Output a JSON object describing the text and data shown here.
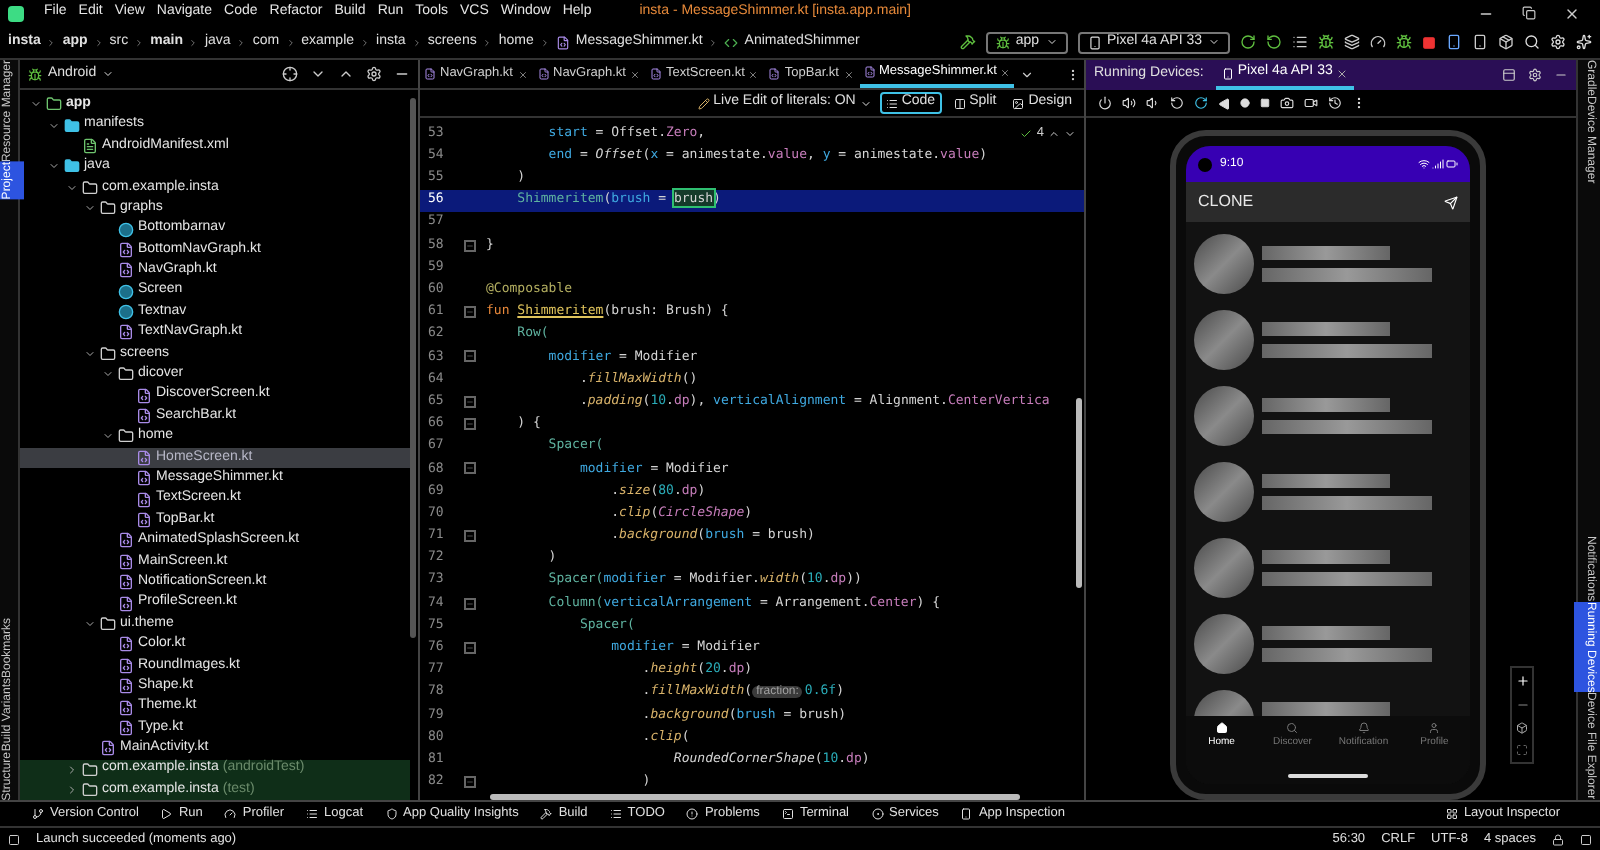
{
  "menu_bar": {
    "items": [
      "File",
      "Edit",
      "View",
      "Navigate",
      "Code",
      "Refactor",
      "Build",
      "Run",
      "Tools",
      "VCS",
      "Window",
      "Help"
    ],
    "title": "insta - MessageShimmer.kt [insta.app.main]"
  },
  "breadcrumbs": [
    {
      "label": "insta",
      "bold": true
    },
    {
      "label": "app",
      "bold": true
    },
    {
      "label": "src",
      "bold": false
    },
    {
      "label": "main",
      "bold": true
    },
    {
      "label": "java",
      "bold": false
    },
    {
      "label": "com",
      "bold": false
    },
    {
      "label": "example",
      "bold": false
    },
    {
      "label": "insta",
      "bold": false
    },
    {
      "label": "screens",
      "bold": false
    },
    {
      "label": "home",
      "bold": false
    },
    {
      "label": "MessageShimmer.kt",
      "bold": false
    },
    {
      "label": "AnimatedShimmer",
      "bold": false
    }
  ],
  "toolbar": {
    "run_config": "app",
    "device": "Pixel 4a API 33"
  },
  "left_stripe": [
    {
      "label": "Resource Manager",
      "selected": false
    },
    {
      "label": "Project",
      "selected": true
    },
    {
      "label": "Bookmarks",
      "selected": false
    },
    {
      "label": "Build Variants",
      "selected": false
    },
    {
      "label": "Structure",
      "selected": false
    }
  ],
  "project": {
    "view": "Android",
    "tree": [
      {
        "label": "app",
        "kind": "module",
        "expanded": true,
        "selected": false,
        "children": [
          {
            "label": "manifests",
            "kind": "folder",
            "expanded": true,
            "selected": false,
            "children": [
              {
                "label": "AndroidManifest.xml",
                "kind": "manifest",
                "selected": false
              }
            ]
          },
          {
            "label": "java",
            "kind": "folder",
            "expanded": true,
            "selected": false,
            "children": [
              {
                "label": "com.example.insta",
                "kind": "package",
                "expanded": true,
                "selected": false,
                "children": [
                  {
                    "label": "graphs",
                    "kind": "package",
                    "expanded": true,
                    "selected": false,
                    "children": [
                      {
                        "label": "Bottombarnav",
                        "kind": "class",
                        "selected": false
                      },
                      {
                        "label": "BottomNavGraph.kt",
                        "kind": "kotlin",
                        "selected": false
                      },
                      {
                        "label": "NavGraph.kt",
                        "kind": "kotlin",
                        "selected": false
                      },
                      {
                        "label": "Screen",
                        "kind": "class",
                        "selected": false
                      },
                      {
                        "label": "Textnav",
                        "kind": "class",
                        "selected": false
                      },
                      {
                        "label": "TextNavGraph.kt",
                        "kind": "kotlin",
                        "selected": false
                      }
                    ]
                  },
                  {
                    "label": "screens",
                    "kind": "package",
                    "expanded": true,
                    "selected": false,
                    "children": [
                      {
                        "label": "dicover",
                        "kind": "package",
                        "expanded": true,
                        "selected": false,
                        "children": [
                          {
                            "label": "DiscoverScreen.kt",
                            "kind": "kotlin",
                            "selected": false
                          },
                          {
                            "label": "SearchBar.kt",
                            "kind": "kotlin",
                            "selected": false
                          }
                        ]
                      },
                      {
                        "label": "home",
                        "kind": "package",
                        "expanded": true,
                        "selected": false,
                        "children": [
                          {
                            "label": "HomeScreen.kt",
                            "kind": "kotlin",
                            "selected": true
                          },
                          {
                            "label": "MessageShimmer.kt",
                            "kind": "kotlin",
                            "selected": false
                          },
                          {
                            "label": "TextScreen.kt",
                            "kind": "kotlin",
                            "selected": false
                          },
                          {
                            "label": "TopBar.kt",
                            "kind": "kotlin",
                            "selected": false
                          }
                        ]
                      },
                      {
                        "label": "AnimatedSplashScreen.kt",
                        "kind": "kotlin",
                        "selected": false
                      },
                      {
                        "label": "MainScreen.kt",
                        "kind": "kotlin",
                        "selected": false
                      },
                      {
                        "label": "NotificationScreen.kt",
                        "kind": "kotlin",
                        "selected": false
                      },
                      {
                        "label": "ProfileScreen.kt",
                        "kind": "kotlin",
                        "selected": false
                      }
                    ]
                  },
                  {
                    "label": "ui.theme",
                    "kind": "package",
                    "expanded": true,
                    "selected": false,
                    "children": [
                      {
                        "label": "Color.kt",
                        "kind": "kotlin",
                        "selected": false
                      },
                      {
                        "label": "RoundImages.kt",
                        "kind": "kotlin",
                        "selected": false
                      },
                      {
                        "label": "Shape.kt",
                        "kind": "kotlin",
                        "selected": false
                      },
                      {
                        "label": "Theme.kt",
                        "kind": "kotlin",
                        "selected": false
                      },
                      {
                        "label": "Type.kt",
                        "kind": "kotlin",
                        "selected": false
                      }
                    ]
                  },
                  {
                    "label": "MainActivity.kt",
                    "kind": "kotlin",
                    "selected": false
                  }
                ]
              },
              {
                "label": "com.example.insta",
                "suffix": "(androidTest)",
                "kind": "package",
                "expanded": false,
                "selected": false
              },
              {
                "label": "com.example.insta",
                "suffix": "(test)",
                "kind": "package",
                "expanded": false,
                "selected": false
              }
            ]
          }
        ]
      }
    ]
  },
  "editor": {
    "tabs": [
      {
        "label": "NavGraph.kt",
        "selected": false
      },
      {
        "label": "NavGraph.kt",
        "selected": false
      },
      {
        "label": "TextScreen.kt",
        "selected": false
      },
      {
        "label": "TopBar.kt",
        "selected": false
      },
      {
        "label": "MessageShimmer.kt",
        "selected": true
      }
    ],
    "live_edit": "Live Edit of literals: ON",
    "modes": [
      {
        "label": "Code",
        "selected": true
      },
      {
        "label": "Split",
        "selected": false
      },
      {
        "label": "Design",
        "selected": false
      }
    ],
    "inspection_count": "4",
    "lines": [
      {
        "number": "53",
        "current": false,
        "fold_marker": false,
        "tokens": [
          {
            "text": "        start",
            "kind": "arg"
          },
          {
            "text": " = Offset.",
            "kind": "plain"
          },
          {
            "text": "Zero",
            "kind": "const"
          },
          {
            "text": ",",
            "kind": "plain"
          }
        ]
      },
      {
        "number": "54",
        "current": false,
        "fold_marker": false,
        "tokens": [
          {
            "text": "        end",
            "kind": "arg"
          },
          {
            "text": " = ",
            "kind": "plain"
          },
          {
            "text": "Offset",
            "kind": "ital"
          },
          {
            "text": "(",
            "kind": "plain"
          },
          {
            "text": "x",
            "kind": "arg"
          },
          {
            "text": " = animestate.",
            "kind": "plain"
          },
          {
            "text": "value",
            "kind": "const"
          },
          {
            "text": ", ",
            "kind": "plain"
          },
          {
            "text": "y",
            "kind": "arg"
          },
          {
            "text": " = animestate.",
            "kind": "plain"
          },
          {
            "text": "value",
            "kind": "const"
          },
          {
            "text": ")",
            "kind": "plain"
          }
        ]
      },
      {
        "number": "55",
        "current": false,
        "fold_marker": false,
        "tokens": [
          {
            "text": "    )",
            "kind": "plain"
          }
        ]
      },
      {
        "number": "56",
        "current": true,
        "fold_marker": false,
        "tokens": [
          {
            "text": "    Shimmeritem",
            "kind": "call"
          },
          {
            "text": "(",
            "kind": "plain"
          },
          {
            "text": "brush",
            "kind": "arg"
          },
          {
            "text": " = ",
            "kind": "plain"
          },
          {
            "text": "brush",
            "kind": "match"
          },
          {
            "text": ")",
            "kind": "plain"
          }
        ]
      },
      {
        "number": "57",
        "current": false,
        "fold_marker": false
      },
      {
        "number": "58",
        "current": false,
        "fold_marker": true,
        "tokens": [
          {
            "text": "}",
            "kind": "plain"
          }
        ]
      },
      {
        "number": "59",
        "current": false,
        "fold_marker": false
      },
      {
        "number": "60",
        "current": false,
        "fold_marker": false,
        "tokens": [
          {
            "text": "@Composable",
            "kind": "ann"
          }
        ]
      },
      {
        "number": "61",
        "current": false,
        "fold_marker": true,
        "tokens": [
          {
            "text": "fun ",
            "kind": "kw"
          },
          {
            "text": "Shimmeritem",
            "kind": "decl"
          },
          {
            "text": "(brush: Brush) {",
            "kind": "plain"
          }
        ]
      },
      {
        "number": "62",
        "current": false,
        "fold_marker": false,
        "tokens": [
          {
            "text": "    Row(",
            "kind": "call"
          }
        ]
      },
      {
        "number": "63",
        "current": false,
        "fold_marker": true,
        "tokens": [
          {
            "text": "        modifier",
            "kind": "arg"
          },
          {
            "text": " = Modifier",
            "kind": "plain"
          }
        ]
      },
      {
        "number": "64",
        "current": false,
        "fold_marker": false,
        "tokens": [
          {
            "text": "            .",
            "kind": "plain"
          },
          {
            "text": "fillMaxWidth",
            "kind": "fn"
          },
          {
            "text": "()",
            "kind": "plain"
          }
        ]
      },
      {
        "number": "65",
        "current": false,
        "fold_marker": true,
        "tokens": [
          {
            "text": "            .",
            "kind": "plain"
          },
          {
            "text": "padding",
            "kind": "fn"
          },
          {
            "text": "(",
            "kind": "plain"
          },
          {
            "text": "10",
            "kind": "num"
          },
          {
            "text": ".",
            "kind": "plain"
          },
          {
            "text": "dp",
            "kind": "const"
          },
          {
            "text": "), ",
            "kind": "plain"
          },
          {
            "text": "verticalAlignment",
            "kind": "arg"
          },
          {
            "text": " = Alignment.",
            "kind": "plain"
          },
          {
            "text": "CenterVertica",
            "kind": "const"
          }
        ]
      },
      {
        "number": "66",
        "current": false,
        "fold_marker": true,
        "tokens": [
          {
            "text": "    ) {",
            "kind": "plain"
          }
        ]
      },
      {
        "number": "67",
        "current": false,
        "fold_marker": false,
        "tokens": [
          {
            "text": "        Spacer(",
            "kind": "call"
          }
        ]
      },
      {
        "number": "68",
        "current": false,
        "fold_marker": true,
        "tokens": [
          {
            "text": "            modifier",
            "kind": "arg"
          },
          {
            "text": " = Modifier",
            "kind": "plain"
          }
        ]
      },
      {
        "number": "69",
        "current": false,
        "fold_marker": false,
        "tokens": [
          {
            "text": "                .",
            "kind": "plain"
          },
          {
            "text": "size",
            "kind": "fn"
          },
          {
            "text": "(",
            "kind": "plain"
          },
          {
            "text": "80",
            "kind": "num"
          },
          {
            "text": ".",
            "kind": "plain"
          },
          {
            "text": "dp",
            "kind": "const"
          },
          {
            "text": ")",
            "kind": "plain"
          }
        ]
      },
      {
        "number": "70",
        "current": false,
        "fold_marker": false,
        "tokens": [
          {
            "text": "                .",
            "kind": "plain"
          },
          {
            "text": "clip",
            "kind": "fn"
          },
          {
            "text": "(",
            "kind": "plain"
          },
          {
            "text": "CircleShape",
            "kind": "constital"
          },
          {
            "text": ")",
            "kind": "plain"
          }
        ]
      },
      {
        "number": "71",
        "current": false,
        "fold_marker": true,
        "tokens": [
          {
            "text": "                .",
            "kind": "plain"
          },
          {
            "text": "background",
            "kind": "fn"
          },
          {
            "text": "(",
            "kind": "plain"
          },
          {
            "text": "brush",
            "kind": "arg"
          },
          {
            "text": " = brush)",
            "kind": "plain"
          }
        ]
      },
      {
        "number": "72",
        "current": false,
        "fold_marker": false,
        "tokens": [
          {
            "text": "        )",
            "kind": "plain"
          }
        ]
      },
      {
        "number": "73",
        "current": false,
        "fold_marker": false,
        "tokens": [
          {
            "text": "        Spacer(",
            "kind": "call"
          },
          {
            "text": "modifier",
            "kind": "arg"
          },
          {
            "text": " = Modifier.",
            "kind": "plain"
          },
          {
            "text": "width",
            "kind": "fn"
          },
          {
            "text": "(",
            "kind": "plain"
          },
          {
            "text": "10",
            "kind": "num"
          },
          {
            "text": ".",
            "kind": "plain"
          },
          {
            "text": "dp",
            "kind": "const"
          },
          {
            "text": "))",
            "kind": "plain"
          }
        ]
      },
      {
        "number": "74",
        "current": false,
        "fold_marker": true,
        "tokens": [
          {
            "text": "        Column(",
            "kind": "call"
          },
          {
            "text": "verticalArrangement",
            "kind": "arg"
          },
          {
            "text": " = Arrangement.",
            "kind": "plain"
          },
          {
            "text": "Center",
            "kind": "const"
          },
          {
            "text": ") {",
            "kind": "plain"
          }
        ]
      },
      {
        "number": "75",
        "current": false,
        "fold_marker": false,
        "tokens": [
          {
            "text": "            Spacer(",
            "kind": "call"
          }
        ]
      },
      {
        "number": "76",
        "current": false,
        "fold_marker": true,
        "tokens": [
          {
            "text": "                modifier",
            "kind": "arg"
          },
          {
            "text": " = Modifier",
            "kind": "plain"
          }
        ]
      },
      {
        "number": "77",
        "current": false,
        "fold_marker": false,
        "tokens": [
          {
            "text": "                    .",
            "kind": "plain"
          },
          {
            "text": "height",
            "kind": "fn"
          },
          {
            "text": "(",
            "kind": "plain"
          },
          {
            "text": "20",
            "kind": "num"
          },
          {
            "text": ".",
            "kind": "plain"
          },
          {
            "text": "dp",
            "kind": "const"
          },
          {
            "text": ")",
            "kind": "plain"
          }
        ]
      },
      {
        "number": "78",
        "current": false,
        "fold_marker": false,
        "tokens": [
          {
            "text": "                    .",
            "kind": "plain"
          },
          {
            "text": "fillMaxWidth",
            "kind": "fn"
          },
          {
            "text": "(",
            "kind": "plain"
          },
          {
            "text": "fraction:",
            "kind": "hint"
          },
          {
            "text": "0.6f",
            "kind": "num"
          },
          {
            "text": ")",
            "kind": "plain"
          }
        ]
      },
      {
        "number": "79",
        "current": false,
        "fold_marker": false,
        "tokens": [
          {
            "text": "                    .",
            "kind": "plain"
          },
          {
            "text": "background",
            "kind": "fn"
          },
          {
            "text": "(",
            "kind": "plain"
          },
          {
            "text": "brush",
            "kind": "arg"
          },
          {
            "text": " = brush)",
            "kind": "plain"
          }
        ]
      },
      {
        "number": "80",
        "current": false,
        "fold_marker": false,
        "tokens": [
          {
            "text": "                    .",
            "kind": "plain"
          },
          {
            "text": "clip",
            "kind": "fn"
          },
          {
            "text": "(",
            "kind": "plain"
          }
        ]
      },
      {
        "number": "81",
        "current": false,
        "fold_marker": false,
        "tokens": [
          {
            "text": "                        RoundedCornerShape",
            "kind": "ital"
          },
          {
            "text": "(",
            "kind": "plain"
          },
          {
            "text": "10",
            "kind": "num"
          },
          {
            "text": ".",
            "kind": "plain"
          },
          {
            "text": "dp",
            "kind": "const"
          },
          {
            "text": ")",
            "kind": "plain"
          }
        ]
      },
      {
        "number": "82",
        "current": false,
        "fold_marker": true,
        "tokens": [
          {
            "text": "                    )",
            "kind": "plain"
          }
        ]
      }
    ]
  },
  "running_devices": {
    "title": "Running Devices:",
    "tabs": [
      {
        "label": "Pixel 4a API 33",
        "selected": true
      }
    ],
    "phone": {
      "time": "9:10",
      "app_title": "CLONE",
      "nav": [
        {
          "label": "Home",
          "kind": "home",
          "selected": true
        },
        {
          "label": "Discover",
          "kind": "search",
          "selected": false
        },
        {
          "label": "Notification",
          "kind": "bell",
          "selected": false
        },
        {
          "label": "Profile",
          "kind": "user",
          "selected": false
        }
      ]
    }
  },
  "right_stripe": [
    {
      "label": "Gradle",
      "selected": false
    },
    {
      "label": "Device Manager",
      "selected": false
    },
    {
      "label": "Notifications",
      "selected": false
    },
    {
      "label": "Running Devices",
      "selected": true
    },
    {
      "label": "Device File Explorer",
      "selected": false
    }
  ],
  "tool_windows": [
    {
      "label": "Version Control",
      "kind": "vcs"
    },
    {
      "label": "Run",
      "kind": "run"
    },
    {
      "label": "Profiler",
      "kind": "profiler"
    },
    {
      "label": "Logcat",
      "kind": "logcat"
    },
    {
      "label": "App Quality Insights",
      "kind": "quality"
    },
    {
      "label": "Build",
      "kind": "build"
    },
    {
      "label": "TODO",
      "kind": "todo"
    },
    {
      "label": "Problems",
      "kind": "problems"
    },
    {
      "label": "Terminal",
      "kind": "terminal"
    },
    {
      "label": "Services",
      "kind": "services"
    },
    {
      "label": "App Inspection",
      "kind": "inspection"
    }
  ],
  "layout_inspector": "Layout Inspector",
  "status_bar": {
    "message": "Launch succeeded (moments ago)",
    "position": "56:30",
    "line_separator": "CRLF",
    "encoding": "UTF-8",
    "indent": "4 spaces"
  }
}
